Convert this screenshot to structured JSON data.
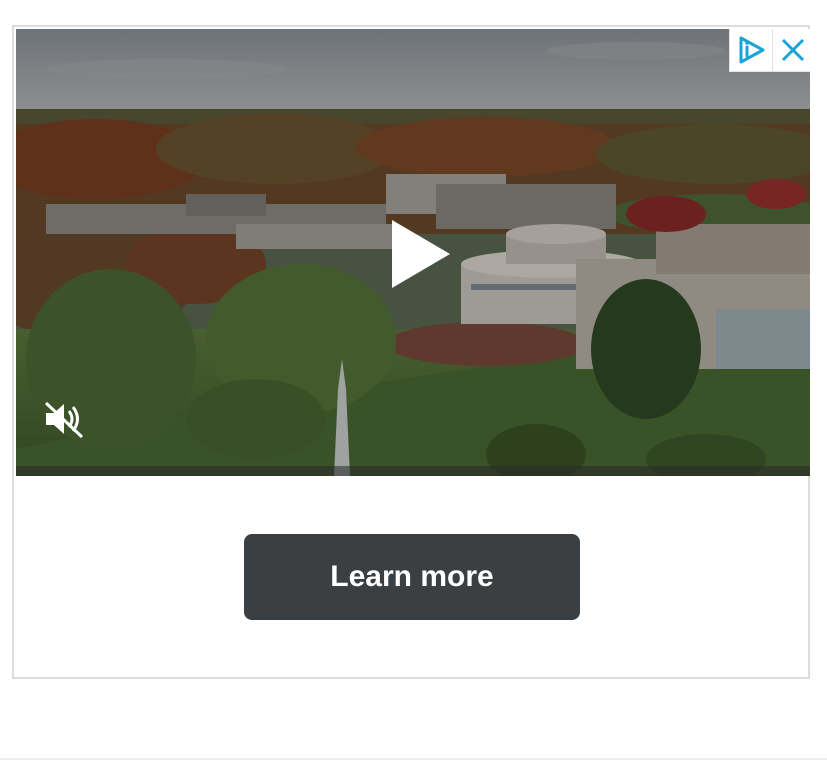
{
  "ad": {
    "cta_label": "Learn more",
    "video": {
      "muted": true,
      "progress": 0,
      "icons": {
        "play": "play-icon",
        "mute": "speaker-muted-icon",
        "adchoices": "adchoices-icon",
        "close": "close-icon"
      }
    },
    "colors": {
      "cta_background": "#3c3f42",
      "cta_text": "#ffffff",
      "adchoices_accent": "#1aa3d6",
      "frame_border": "#dcdcdc"
    }
  }
}
